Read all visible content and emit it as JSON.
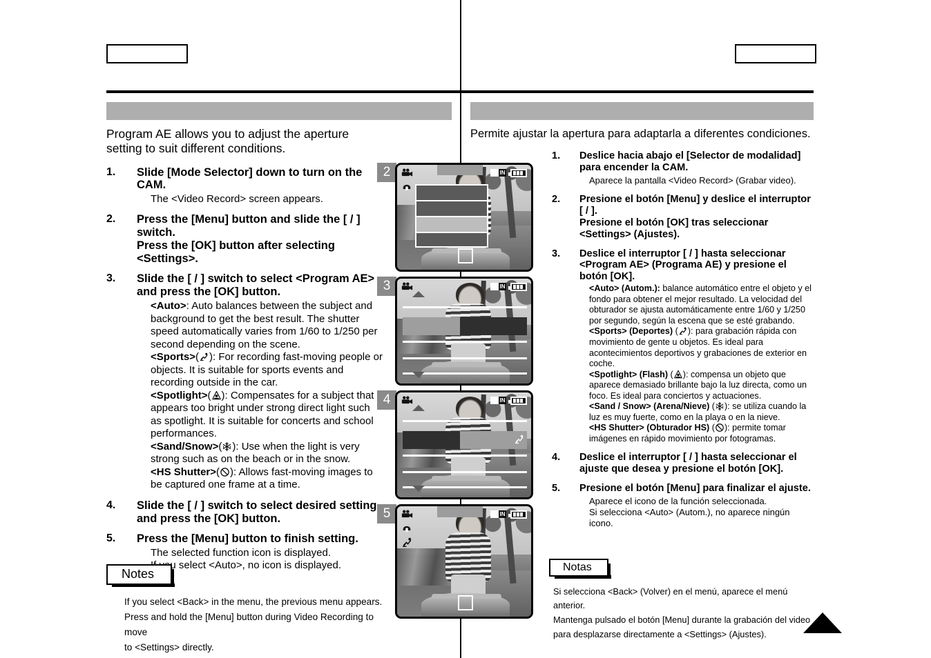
{
  "header": {
    "left_box_label": "",
    "right_box_label": ""
  },
  "titles": {
    "left": "",
    "right": ""
  },
  "english": {
    "intro": "Program AE allows you to adjust the aperture setting to suit different conditions.",
    "steps": [
      {
        "num": "1.",
        "head": "Slide [Mode Selector] down to turn on the CAM.",
        "sub": "The <Video Record> screen appears."
      },
      {
        "num": "2.",
        "head": "Press the [Menu] button and slide the [    /    ] switch.\nPress the [OK] button after selecting <Settings>."
      },
      {
        "num": "3.",
        "head": "Slide the [    /    ] switch to select <Program AE> and press the [OK] button.",
        "items": [
          {
            "name": "<Auto>",
            "icon": "",
            "text": ": Auto balances between the subject and background to get the best result. The shutter speed automatically varies from 1/60 to 1/250 per second depending on the scene."
          },
          {
            "name": "<Sports>",
            "icon": "sports-icon",
            "text": ": For recording fast-moving people or objects. It is suitable for sports events and recording outside in the car."
          },
          {
            "name": "<Spotlight>",
            "icon": "spotlight-icon",
            "text": ": Compensates for a subject that appears too bright under strong direct light such as spotlight. It is suitable for concerts and school performances."
          },
          {
            "name": "<Sand/Snow>",
            "icon": "snowflake-icon",
            "text": ": Use when the light is very strong such as on the beach or in the snow."
          },
          {
            "name": "<HS Shutter>",
            "icon": "hs-shutter-icon",
            "text": ": Allows fast-moving images to be captured one frame at a time."
          }
        ]
      },
      {
        "num": "4.",
        "head": "Slide the [    /    ] switch to select desired setting and press the [OK] button."
      },
      {
        "num": "5.",
        "head": "Press the [Menu] button to finish setting.",
        "sub": "The selected function icon is displayed.\nIf you select <Auto>, no icon is displayed."
      }
    ],
    "notes_label": "Notes",
    "notes": "If you select <Back> in the menu, the previous menu appears.\nPress and hold the [Menu] button during Video Recording to move\nto <Settings> directly."
  },
  "spanish": {
    "intro": "Permite ajustar la apertura para adaptarla a diferentes condiciones.",
    "steps": [
      {
        "num": "1.",
        "head": "Deslice hacia abajo el [Selector de modalidad] para encender la CAM.",
        "sub": "Aparece la pantalla <Video Record> (Grabar video)."
      },
      {
        "num": "2.",
        "head": "Presione el botón [Menu] y deslice el interruptor [    /    ].\nPresione el botón [OK] tras seleccionar <Settings> (Ajustes)."
      },
      {
        "num": "3.",
        "head": "Deslice el interruptor [    /    ] hasta seleccionar <Program AE> (Programa AE) y presione el botón [OK].",
        "items": [
          {
            "name": "<Auto> (Autom.):",
            "icon": "",
            "text": " balance automático entre el objeto y el fondo para obtener el mejor resultado. La velocidad del obturador se ajusta automáticamente entre 1/60 y 1/250 por segundo, según la escena que se esté grabando."
          },
          {
            "name": "<Sports> (Deportes)",
            "icon": "sports-icon",
            "text": ": para grabación rápida con movimiento de gente u objetos. Es ideal para acontecimientos deportivos y grabaciones de exterior en coche."
          },
          {
            "name": "<Spotlight> (Flash)",
            "icon": "spotlight-icon",
            "text": ": compensa un objeto que aparece demasiado brillante bajo la luz directa, como un foco. Es ideal para conciertos y actuaciones."
          },
          {
            "name": "<Sand / Snow> (Arena/Nieve)",
            "icon": "snowflake-icon",
            "text": ": se utiliza cuando la luz es muy fuerte, como en la playa o en la nieve."
          },
          {
            "name": "<HS Shutter> (Obturador HS)",
            "icon": "hs-shutter-icon",
            "text": ": permite tomar imágenes en rápido movimiento por fotogramas."
          }
        ]
      },
      {
        "num": "4.",
        "head": "Deslice el interruptor [    /    ] hasta seleccionar el ajuste que desea y presione el botón [OK]."
      },
      {
        "num": "5.",
        "head": "Presione el botón [Menu] para finalizar el ajuste.",
        "sub": "Aparece el icono de la función seleccionada.\nSi selecciona <Auto> (Autom.), no aparece ningún icono."
      }
    ],
    "notes_label": "Notas",
    "notes": "Si selecciona <Back> (Volver) en el menú, aparece el menú anterior.\nMantenga pulsado el botón [Menu] durante la grabación del video\npara desplazarse directamente a <Settings> (Ajustes)."
  },
  "screens": [
    {
      "badge": "2",
      "type": "menu",
      "in_tag": "IN"
    },
    {
      "badge": "3",
      "type": "list",
      "in_tag": "IN"
    },
    {
      "badge": "4",
      "type": "list-selected",
      "in_tag": "IN"
    },
    {
      "badge": "5",
      "type": "preview",
      "in_tag": "IN"
    }
  ],
  "colors": {
    "title_bar": "#aeaeae",
    "badge": "#8a8a8a",
    "rule": "#000000"
  }
}
